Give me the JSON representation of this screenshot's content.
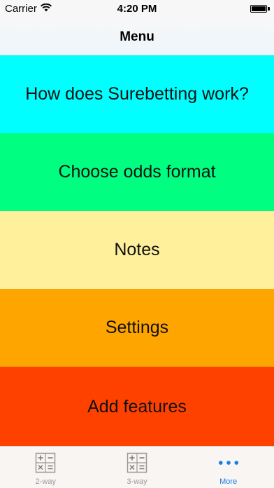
{
  "status_bar": {
    "carrier": "Carrier",
    "time": "4:20 PM",
    "icons": [
      "wifi-icon",
      "battery-icon"
    ]
  },
  "nav": {
    "title": "Menu"
  },
  "menu": {
    "items": [
      {
        "label": "How does Surebetting work?",
        "color": "#00ffff"
      },
      {
        "label": "Choose odds format",
        "color": "#00ff80"
      },
      {
        "label": "Notes",
        "color": "#fff09c"
      },
      {
        "label": "Settings",
        "color": "#ffa500"
      },
      {
        "label": "Add features",
        "color": "#ff4100"
      }
    ]
  },
  "tab_bar": {
    "tabs": [
      {
        "label": "2-way",
        "icon": "calculator-icon",
        "active": false
      },
      {
        "label": "3-way",
        "icon": "calculator-icon",
        "active": false
      },
      {
        "label": "More",
        "icon": "more-dots-icon",
        "active": true
      }
    ],
    "active_color": "#1a7fe0",
    "inactive_color": "#9a9a9a"
  }
}
